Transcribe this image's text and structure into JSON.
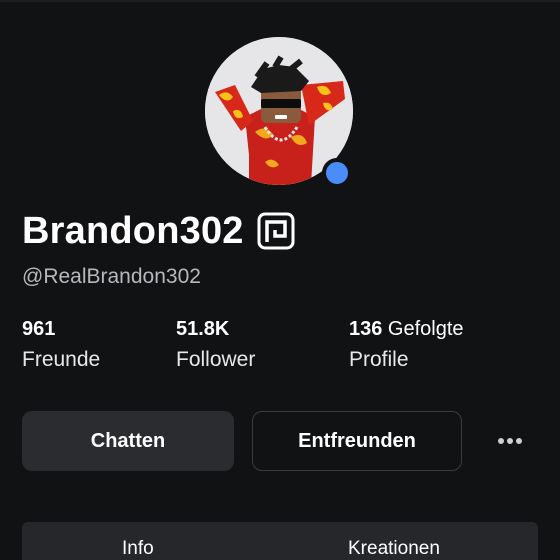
{
  "profile": {
    "display_name": "Brandon302",
    "username": "@RealBrandon302",
    "online_status_color": "#4b8df8",
    "premium_icon": "premium-badge-icon"
  },
  "stats": [
    {
      "value": "961",
      "value_rest": "",
      "label": "Freunde"
    },
    {
      "value": "51.8K",
      "value_rest": "",
      "label": "Follower"
    },
    {
      "value": "136",
      "value_rest": " Gefolgte",
      "label": "Profile"
    }
  ],
  "actions": {
    "chat_label": "Chatten",
    "unfriend_label": "Entfreunden",
    "more_icon": "more-horizontal-icon"
  },
  "tabs": [
    {
      "label": "Info"
    },
    {
      "label": "Kreationen"
    }
  ]
}
